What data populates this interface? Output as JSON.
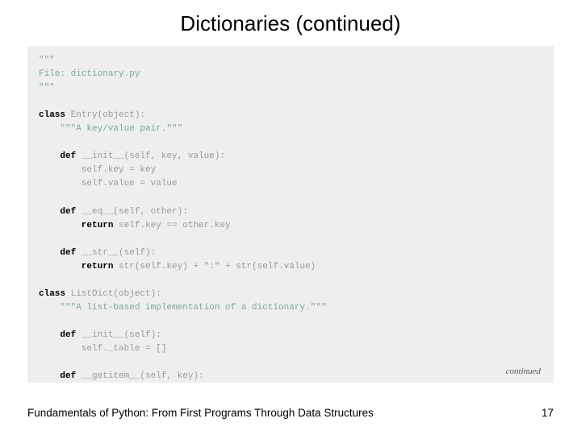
{
  "title": "Dictionaries (continued)",
  "code": {
    "l0": "\"\"\"",
    "l1": "File: dictionary.py",
    "l2": "\"\"\"",
    "l3_kw": "class",
    "l3_rest": " Entry(object):",
    "l4": "    \"\"\"A key/value pair.\"\"\"",
    "l5_kw": "    def",
    "l5_rest": " __init__(self, key, value):",
    "l6": "        self.key = key",
    "l7": "        self.value = value",
    "l8_kw": "    def",
    "l8_rest": " __eq__(self, other):",
    "l9_kw": "        return",
    "l9_rest": " self.key == other.key",
    "l10_kw": "    def",
    "l10_rest": " __str__(self):",
    "l11_kw": "        return",
    "l11_rest": " str(self.key) + \":\" + str(self.value)",
    "l12_kw": "class",
    "l12_rest": " ListDict(object):",
    "l13": "    \"\"\"A list-based implementation of a dictionary.\"\"\"",
    "l14_kw": "    def",
    "l14_rest": " __init__(self):",
    "l15": "        self._table = []",
    "l16_kw": "    def",
    "l16_rest": " __getitem__(self, key):"
  },
  "continued": "continued",
  "footer": "Fundamentals of Python: From First Programs Through Data Structures",
  "page": "17"
}
